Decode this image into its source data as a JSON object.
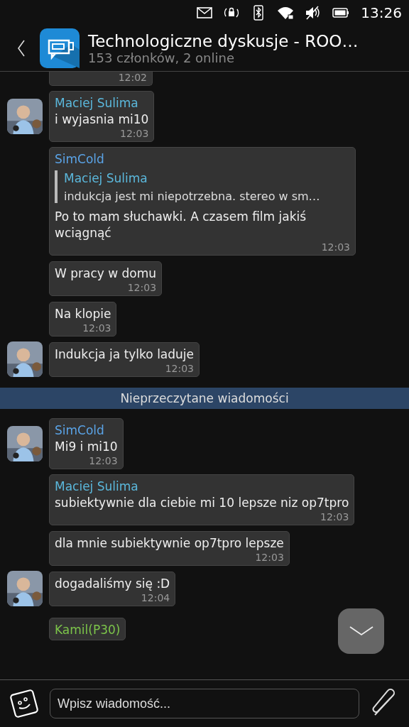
{
  "status_bar": {
    "time": "13:26"
  },
  "header": {
    "title": "Technologiczne dyskusje - ROO…",
    "subtitle": "153 członków, 2 online"
  },
  "messages": [
    {
      "kind": "partial",
      "time": "12:02",
      "avatar": false
    },
    {
      "kind": "message",
      "sender": "Maciej Sulima",
      "color": "#5bb8dc",
      "text": "i wyjasnia mi10",
      "time": "12:03",
      "avatar": true
    },
    {
      "kind": "message",
      "sender": "SimCold",
      "color": "#5aa3e6",
      "quote": {
        "author": "Maciej Sulima",
        "color": "#5bb8dc",
        "text": "indukcja jest mi niepotrzebna. stereo w sm…"
      },
      "text": "Po to mam słuchawki. A czasem film jakiś wciągnąć",
      "time": "12:03",
      "avatar": false
    },
    {
      "kind": "message",
      "text": "W pracy w domu",
      "time": "12:03",
      "avatar": false
    },
    {
      "kind": "message",
      "text": "Na klopie",
      "time": "12:03",
      "avatar": false
    },
    {
      "kind": "message",
      "text": "Indukcja ja tylko laduje",
      "time": "12:03",
      "avatar": true
    },
    {
      "kind": "divider",
      "text": "Nieprzeczytane wiadomości"
    },
    {
      "kind": "message",
      "sender": "SimCold",
      "color": "#5aa3e6",
      "text": "Mi9 i mi10",
      "time": "12:03",
      "avatar": true
    },
    {
      "kind": "message",
      "sender": "Maciej Sulima",
      "color": "#5bb8dc",
      "text": "subiektywnie dla ciebie mi 10 lepsze niz op7tpro",
      "time": "12:03",
      "avatar": false
    },
    {
      "kind": "message",
      "text": "dla mnie subiektywnie op7tpro lepsze",
      "time": "12:03",
      "avatar": false
    },
    {
      "kind": "message",
      "text": "dogadaliśmy się :D",
      "time": "12:04",
      "avatar": true
    },
    {
      "kind": "message",
      "sender": "Kamil(P30)",
      "color": "#7cc44a",
      "avatar": false
    }
  ],
  "composer": {
    "placeholder": "Wpisz wiadomość..."
  }
}
